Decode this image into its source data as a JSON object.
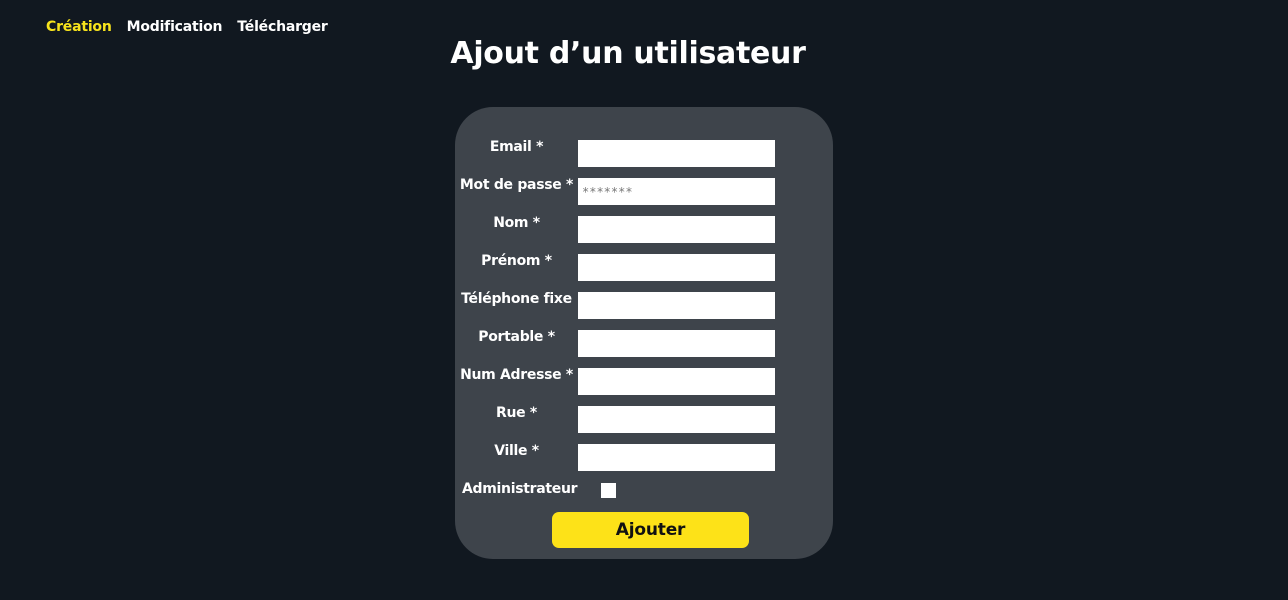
{
  "nav": {
    "items": [
      {
        "label": "Création",
        "active": true
      },
      {
        "label": "Modification",
        "active": false
      },
      {
        "label": "Télécharger",
        "active": false
      }
    ]
  },
  "page": {
    "title": "Ajout d’un utilisateur"
  },
  "form": {
    "fields": [
      {
        "label": "Email *",
        "type": "text",
        "value": ""
      },
      {
        "label": "Mot de passe *",
        "type": "password",
        "value": "",
        "placeholder": "*******"
      },
      {
        "label": "Nom *",
        "type": "text",
        "value": ""
      },
      {
        "label": "Prénom *",
        "type": "text",
        "value": ""
      },
      {
        "label": "Téléphone fixe",
        "type": "text",
        "value": ""
      },
      {
        "label": "Portable *",
        "type": "text",
        "value": ""
      },
      {
        "label": "Num Adresse *",
        "type": "text",
        "value": ""
      },
      {
        "label": "Rue *",
        "type": "text",
        "value": ""
      },
      {
        "label": "Ville *",
        "type": "text",
        "value": ""
      }
    ],
    "admin": {
      "label": "Administrateur",
      "checked": false
    },
    "submit_label": "Ajouter"
  },
  "colors": {
    "background": "#111820",
    "card": "#3e444b",
    "accent": "#fde218",
    "nav_active": "#f7e31c"
  }
}
